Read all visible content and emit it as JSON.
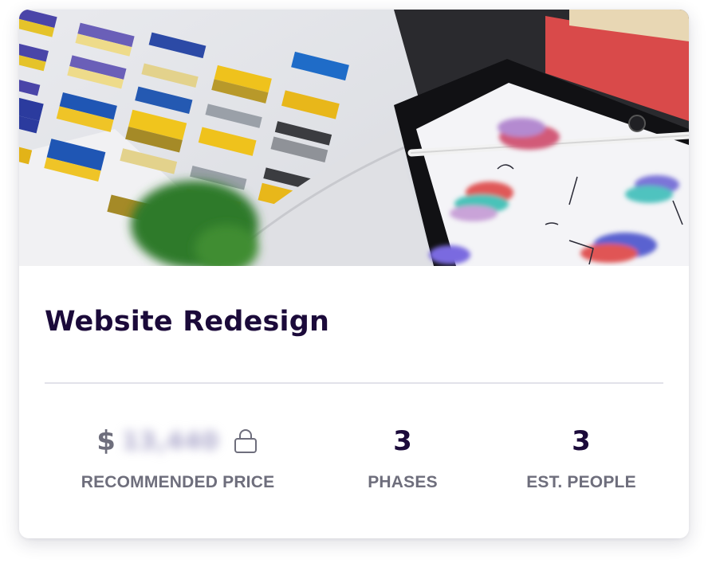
{
  "project": {
    "title": "Website Redesign",
    "hero_image_alt": "Color swatch book and tablet with sketches"
  },
  "stats": {
    "price": {
      "currency": "$",
      "value": "13,440",
      "label": "RECOMMENDED PRICE",
      "locked": true
    },
    "phases": {
      "value": "3",
      "label": "PHASES"
    },
    "people": {
      "value": "3",
      "label": "EST. PEOPLE"
    }
  },
  "colors": {
    "title": "#1b0a3a",
    "muted": "#6e6e7c",
    "divider": "#e2e2ea"
  },
  "icons": {
    "lock": "lock-icon"
  }
}
